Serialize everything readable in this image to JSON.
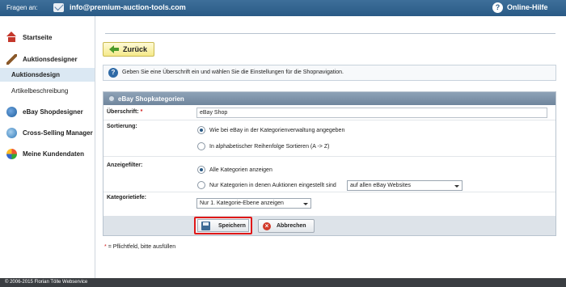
{
  "topbar": {
    "ask_label": "Fragen an:",
    "email": "info@premium-auction-tools.com",
    "help_label": "Online-Hilfe"
  },
  "sidebar": {
    "items": [
      {
        "label": "Startseite",
        "icon": "home-icon"
      },
      {
        "label": "Auktionsdesigner",
        "icon": "brush-icon"
      },
      {
        "label": "eBay Shopdesigner",
        "icon": "ebay-icon"
      },
      {
        "label": "Cross-Selling Manager",
        "icon": "cross-selling-icon"
      },
      {
        "label": "Meine Kundendaten",
        "icon": "customer-data-icon"
      }
    ],
    "sub_items": [
      {
        "label": "Auktionsdesign",
        "active": true
      },
      {
        "label": "Artikelbeschreibung",
        "active": false
      }
    ]
  },
  "main": {
    "back_button": "Zurück",
    "info_text": "Geben Sie eine Überschrift ein und wählen Sie die Einstellungen für die Shopnavigation.",
    "panel_title": "eBay Shopkategorien",
    "fields": {
      "heading": {
        "label": "Überschrift:",
        "required_mark": "*",
        "value": "eBay Shop"
      },
      "sort": {
        "label": "Sortierung:",
        "options": [
          "Wie bei eBay in der Kategorienverwaltung angegeben",
          "In alphabetischer Reihenfolge Sortieren (A -> Z)"
        ],
        "selected": 0
      },
      "filter": {
        "label": "Anzeigefilter:",
        "options": [
          "Alle Kategorien anzeigen",
          "Nur Kategorien in denen Auktionen eingestellt sind"
        ],
        "selected": 0,
        "site_select": "auf allen eBay Websites"
      },
      "depth": {
        "label": "Kategorietiefe:",
        "value": "Nur 1. Kategorie-Ebene anzeigen"
      }
    },
    "save_button": "Speichern",
    "cancel_button": "Abbrechen",
    "footnote": {
      "mark": "*",
      "text": "= Pflichtfeld, bitte ausfüllen"
    }
  },
  "footer": {
    "text": "© 2006-2015 Florian Tölle Webservice"
  },
  "colors": {
    "header": "#2f5f8b",
    "highlight": "#e01818",
    "panel_head": "#7f94a9"
  }
}
